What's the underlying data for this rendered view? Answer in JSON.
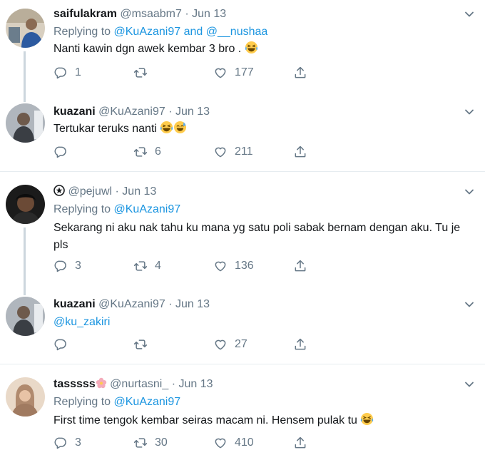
{
  "tweets": [
    {
      "name": "saifulakram",
      "handle": "@msaabm7",
      "date": "Jun 13",
      "replying_prefix": "Replying to",
      "replying_to_1": "@KuAzani97",
      "replying_and": "and",
      "replying_to_2": "@__nushaa",
      "text": "Nanti kawin dgn awek kembar 3 bro .",
      "emojis": [
        "face-with-tears-of-joy"
      ],
      "replies": "1",
      "retweets": "",
      "likes": "177"
    },
    {
      "name": "kuazani",
      "handle": "@KuAzani97",
      "date": "Jun 13",
      "text": "Tertukar teruks nanti",
      "emojis": [
        "face-with-tears-of-joy",
        "grinning-face-with-sweat"
      ],
      "replies": "",
      "retweets": "6",
      "likes": "211"
    },
    {
      "name": "",
      "name_icon": "circled-symbol-icon",
      "handle": "@pejuwl",
      "date": "Jun 13",
      "replying_prefix": "Replying to",
      "replying_to_1": "@KuAzani97",
      "text": "Sekarang ni aku nak tahu ku mana yg satu poli sabak bernam dengan aku. Tu je pls",
      "replies": "3",
      "retweets": "4",
      "likes": "136"
    },
    {
      "name": "kuazani",
      "handle": "@KuAzani97",
      "date": "Jun 13",
      "text": "@ku_zakiri",
      "replies": "",
      "retweets": "",
      "likes": "27"
    },
    {
      "name": "tasssss",
      "name_emoji": "cherry-blossom",
      "handle": "@nurtasni_",
      "date": "Jun 13",
      "replying_prefix": "Replying to",
      "replying_to_1": "@KuAzani97",
      "text": "First time tengok kembar seiras macam ni. Hensem pulak tu",
      "emojis": [
        "face-with-tears-of-joy"
      ],
      "replies": "3",
      "retweets": "30",
      "likes": "410"
    }
  ],
  "dot": "·",
  "colors": {
    "link": "#1b95e0",
    "muted": "#657786",
    "text": "#14171a",
    "thread": "#ccd6dd"
  }
}
